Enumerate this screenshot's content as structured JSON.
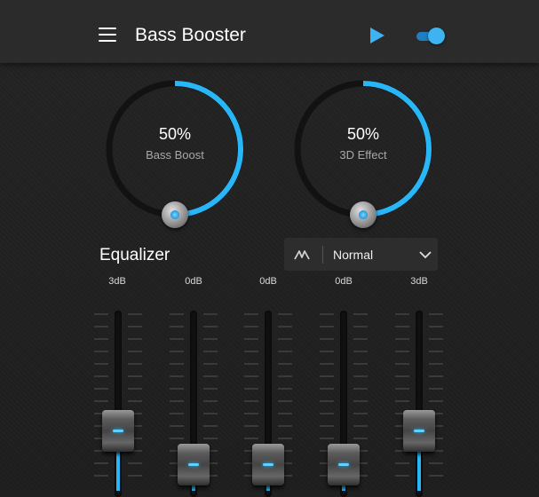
{
  "app": {
    "title": "Bass Booster"
  },
  "colors": {
    "accent": "#29b6f6",
    "appbar": "#2b2b2b",
    "background": "#202020"
  },
  "toolbar": {
    "menu_icon": "menu-icon",
    "play_icon": "play-icon",
    "toggle_on": true
  },
  "knobs": [
    {
      "value": "50%",
      "label": "Bass Boost",
      "level": 0.5
    },
    {
      "value": "50%",
      "label": "3D Effect",
      "level": 0.5
    }
  ],
  "equalizer": {
    "title": "Equalizer",
    "preset": {
      "icon": "wave-icon",
      "value": "Normal",
      "chevron": "chevron-down-icon"
    },
    "bands": [
      {
        "label": "3dB",
        "level": 0.63
      },
      {
        "label": "0dB",
        "level": 0.5
      },
      {
        "label": "0dB",
        "level": 0.5
      },
      {
        "label": "0dB",
        "level": 0.5
      },
      {
        "label": "3dB",
        "level": 0.63
      }
    ]
  }
}
